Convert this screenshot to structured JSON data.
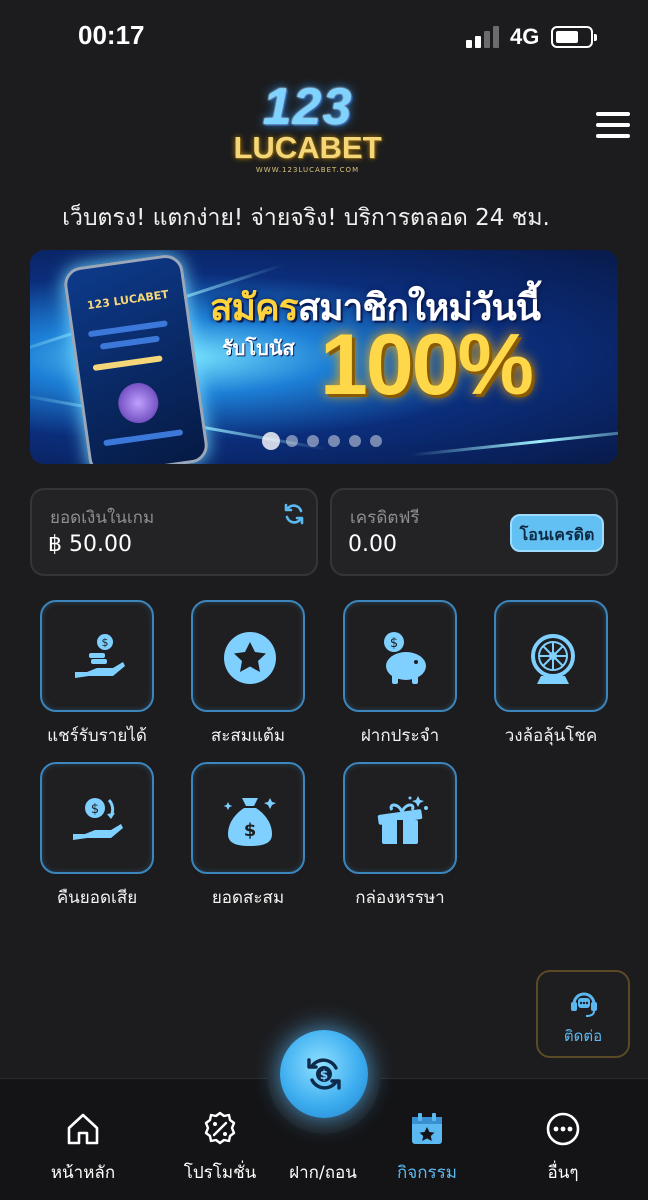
{
  "status_bar": {
    "time": "00:17",
    "network": "4G"
  },
  "header": {
    "logo_number": "123",
    "logo_word": "LUCABET",
    "logo_url": "WWW.123LUCABET.COM"
  },
  "tagline": "เว็บตรง! แตกง่าย! จ่ายจริง! บริการตลอด 24 ชม.",
  "banner": {
    "title_gold": "สมัคร",
    "title_white": "สมาชิกใหม่วันนี้",
    "subtitle": "รับโบนัส",
    "big_text": "100%",
    "phone_brand": "123 LUCABET",
    "slide_count": 6,
    "active_slide": 1
  },
  "wallet": {
    "balance_label": "ยอดเงินในเกม",
    "balance_value": "฿ 50.00",
    "credit_label": "เครดิตฟรี",
    "credit_value": "0.00",
    "transfer_button": "โอนเครดิต"
  },
  "menu_tiles": [
    {
      "label": "แชร์รับรายได้",
      "icon": "coin-hand-icon"
    },
    {
      "label": "สะสมแต้ม",
      "icon": "star-icon"
    },
    {
      "label": "ฝากประจำ",
      "icon": "piggy-bank-icon"
    },
    {
      "label": "วงล้อลุ้นโชค",
      "icon": "wheel-icon"
    },
    {
      "label": "คืนยอดเสีย",
      "icon": "cashback-hand-icon"
    },
    {
      "label": "ยอดสะสม",
      "icon": "money-bag-icon"
    },
    {
      "label": "กล่องหรรษา",
      "icon": "gift-box-icon"
    }
  ],
  "chat": {
    "label": "ติดต่อ",
    "icon": "headset-chat-icon"
  },
  "bottom_nav": [
    {
      "label": "หน้าหลัก",
      "icon": "home-icon"
    },
    {
      "label": "โปรโมชั่น",
      "icon": "promotion-icon"
    },
    {
      "label": "ฝาก/ถอน",
      "icon": "deposit-withdraw-icon"
    },
    {
      "label": "กิจกรรม",
      "icon": "calendar-star-icon",
      "active": true
    },
    {
      "label": "อื่นๆ",
      "icon": "more-icon"
    }
  ],
  "colors": {
    "accent": "#5cb8f0",
    "background": "#1c1c1e",
    "tile_border": "#3a86bd",
    "gold": "#ffd33b"
  }
}
